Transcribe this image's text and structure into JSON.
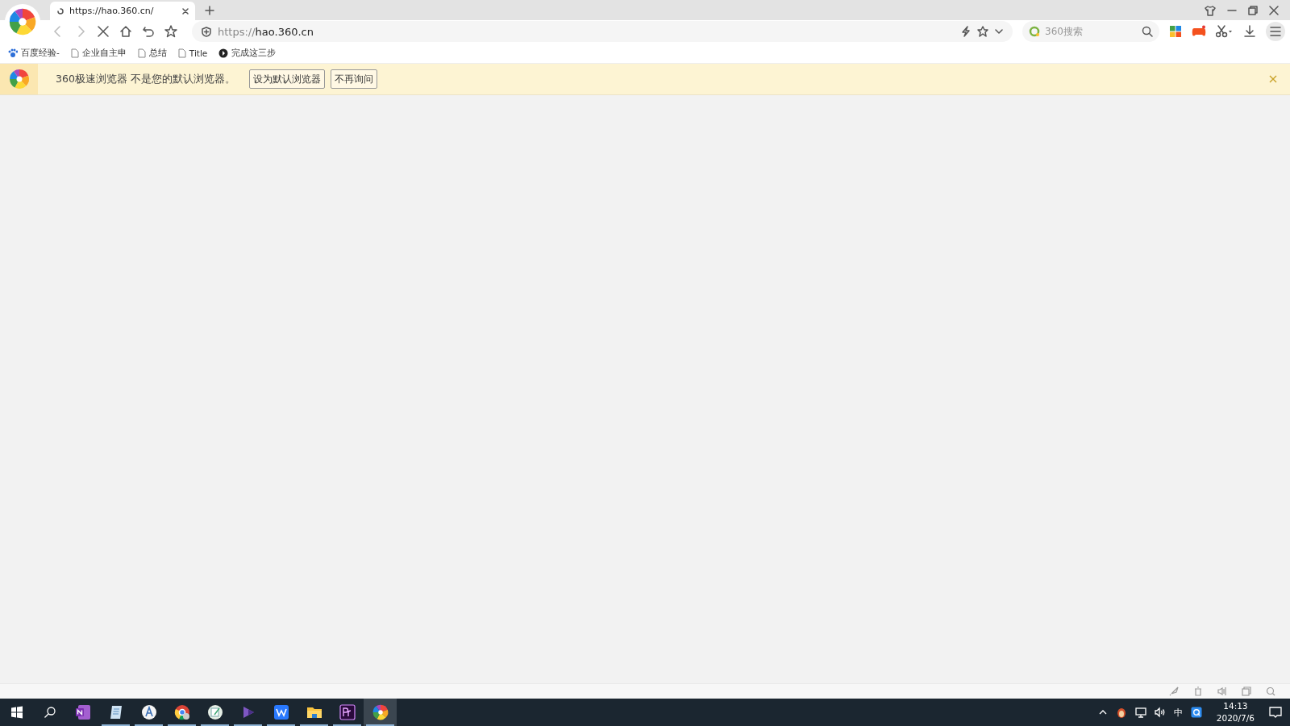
{
  "tab": {
    "title": "https://hao.360.cn/",
    "loading": true
  },
  "toolbar": {
    "address_scheme": "https://",
    "address_host": "hao.360.cn",
    "search_placeholder": "360搜索"
  },
  "bookmarks": [
    {
      "label": "百度经验-",
      "kind": "paw"
    },
    {
      "label": "企业自主申",
      "kind": "page"
    },
    {
      "label": "总结",
      "kind": "page"
    },
    {
      "label": "Title",
      "kind": "page"
    },
    {
      "label": "完成这三步",
      "kind": "circle"
    }
  ],
  "infobar": {
    "message": "360极速浏览器 不是您的默认浏览器。",
    "buttons": [
      "设为默认浏览器",
      "不再询问"
    ]
  },
  "taskbar": {
    "apps": [
      {
        "kind": "onenote",
        "running": false,
        "selected": false
      },
      {
        "kind": "notepad",
        "running": true,
        "selected": false
      },
      {
        "kind": "letter",
        "running": true,
        "selected": false
      },
      {
        "kind": "chrome",
        "running": true,
        "selected": false
      },
      {
        "kind": "editor",
        "running": true,
        "selected": false
      },
      {
        "kind": "play",
        "running": true,
        "selected": false
      },
      {
        "kind": "wps",
        "running": true,
        "selected": false
      },
      {
        "kind": "folder",
        "running": true,
        "selected": false
      },
      {
        "kind": "premiere",
        "running": true,
        "selected": false
      },
      {
        "kind": "browser",
        "running": true,
        "selected": true
      }
    ],
    "ime": "中",
    "time": "14:13",
    "date": "2020/7/6"
  }
}
